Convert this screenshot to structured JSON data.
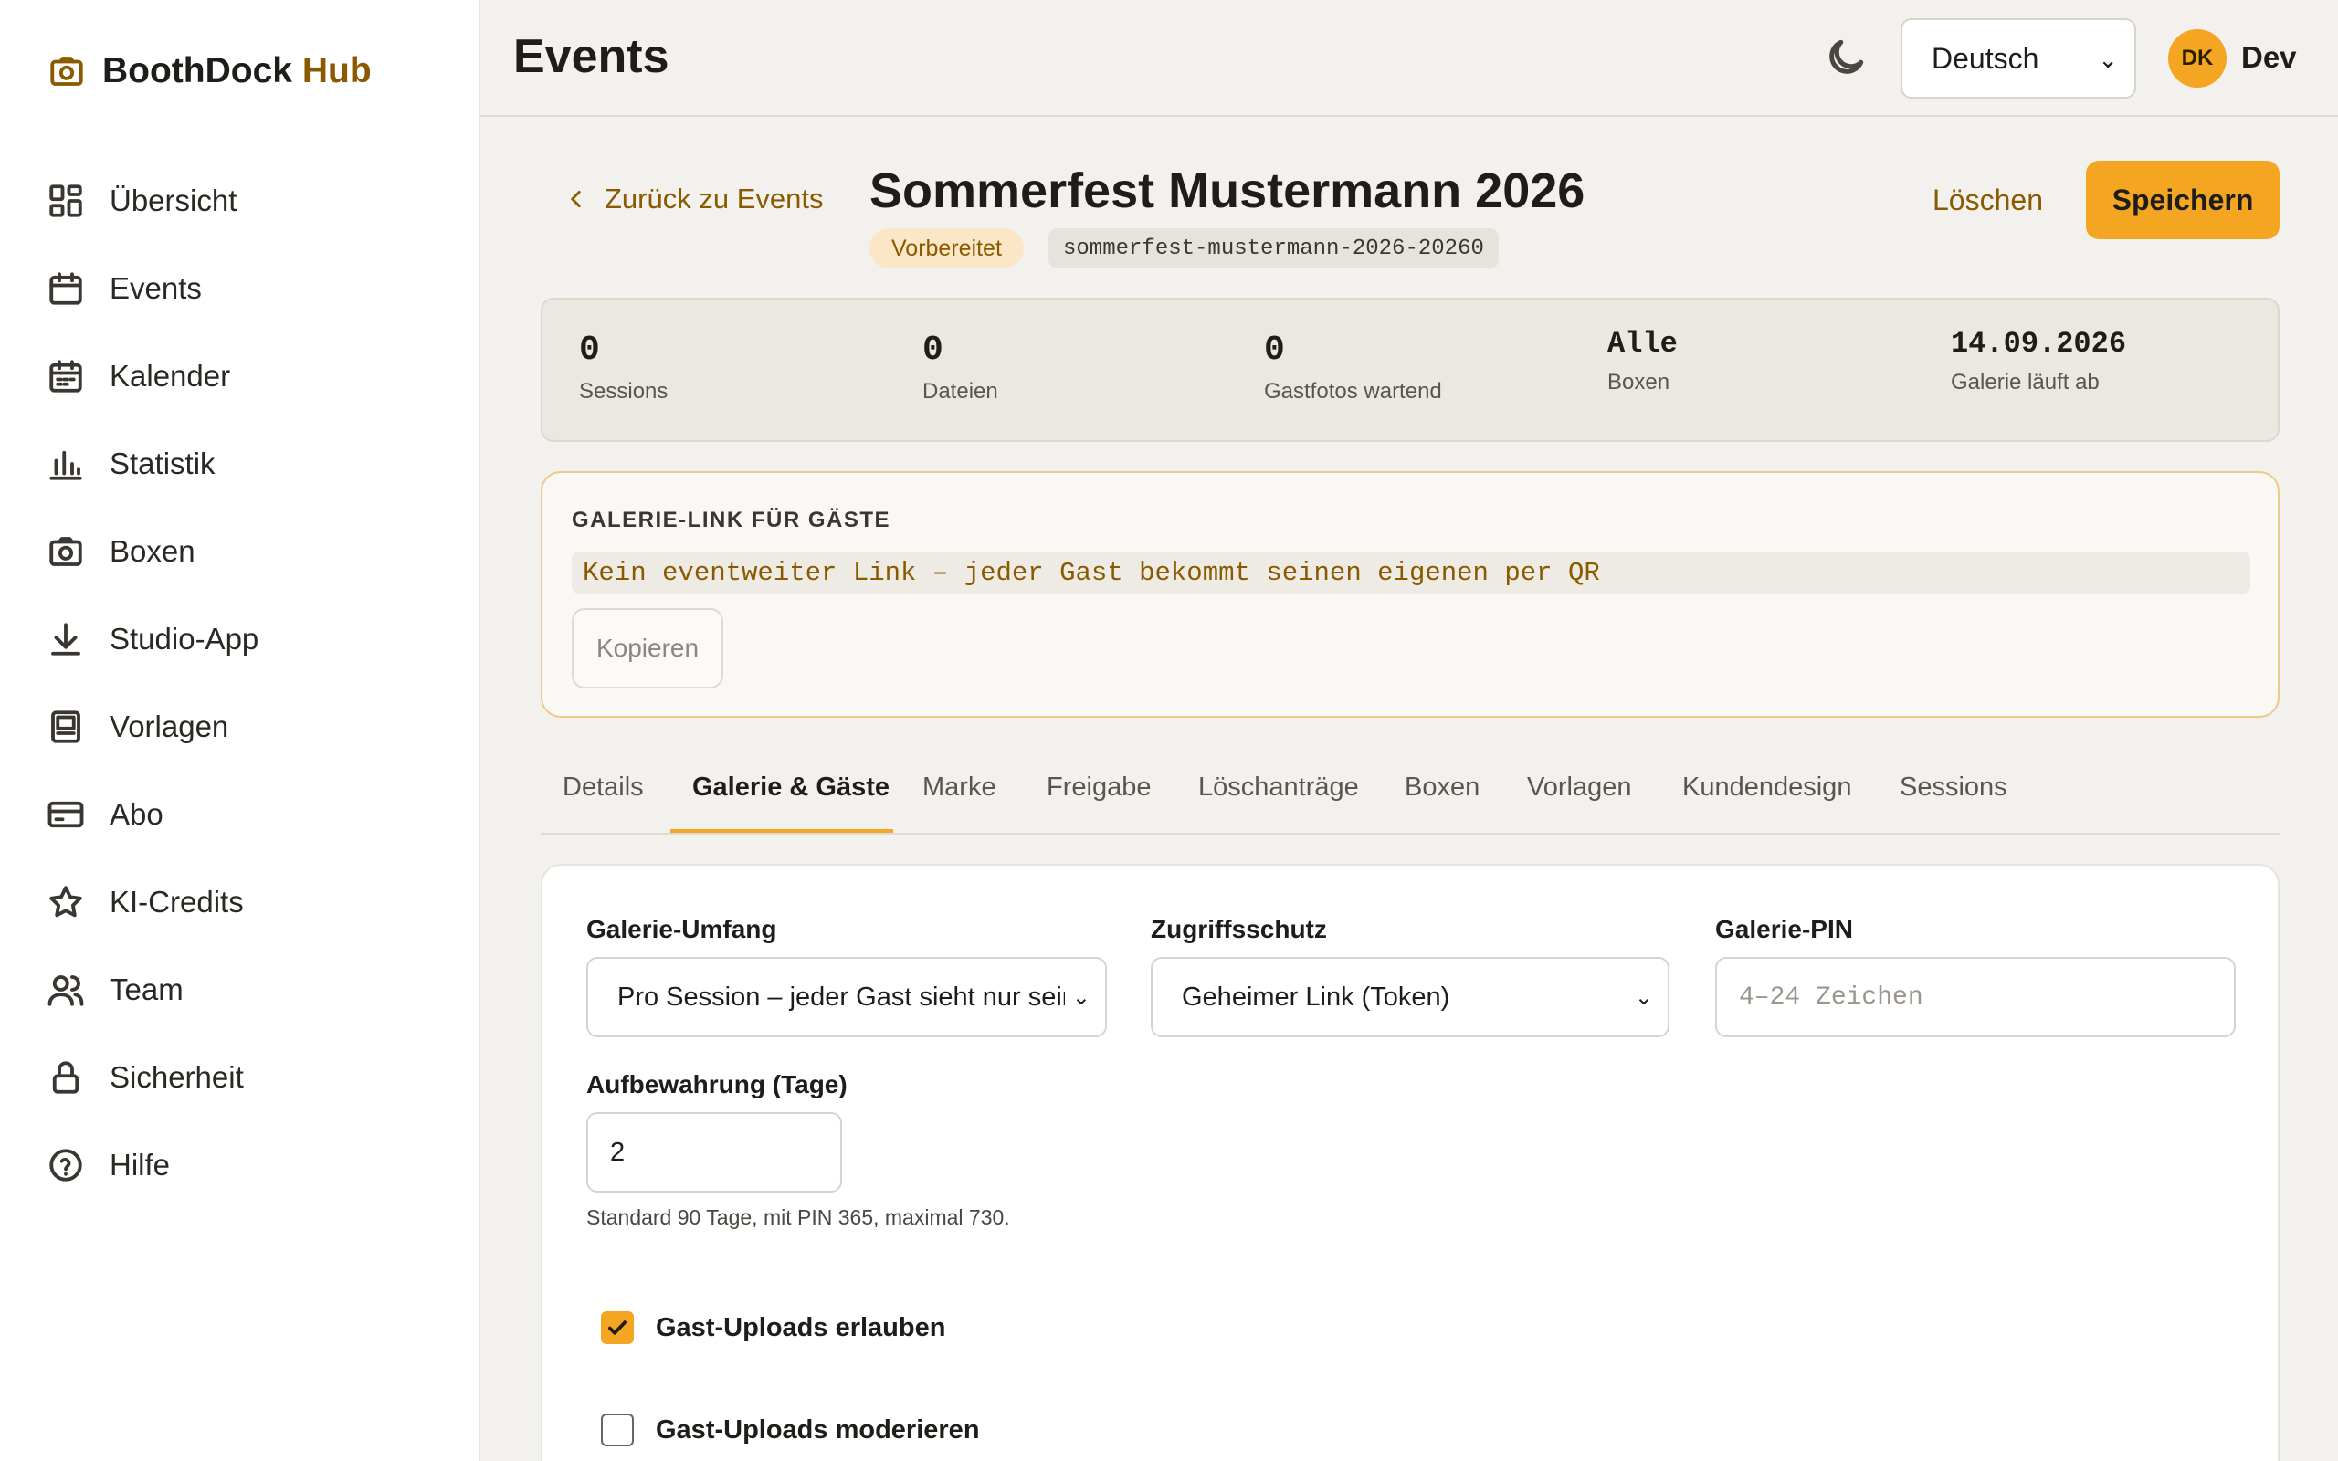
{
  "app": {
    "brand_main": "BoothDock",
    "brand_accent": "Hub",
    "accent_color": "#f4a623",
    "brand_color": "#8a5a00"
  },
  "sidebar": {
    "items": [
      {
        "label": "Übersicht",
        "icon": "dashboard-icon"
      },
      {
        "label": "Events",
        "icon": "calendar-icon"
      },
      {
        "label": "Kalender",
        "icon": "calendar-grid-icon"
      },
      {
        "label": "Statistik",
        "icon": "bar-chart-icon"
      },
      {
        "label": "Boxen",
        "icon": "camera-icon"
      },
      {
        "label": "Studio-App",
        "icon": "download-icon"
      },
      {
        "label": "Vorlagen",
        "icon": "template-icon"
      },
      {
        "label": "Abo",
        "icon": "credit-card-icon"
      },
      {
        "label": "KI-Credits",
        "icon": "star-icon"
      },
      {
        "label": "Team",
        "icon": "users-icon"
      },
      {
        "label": "Sicherheit",
        "icon": "lock-icon"
      },
      {
        "label": "Hilfe",
        "icon": "help-circle-icon"
      }
    ]
  },
  "header": {
    "title": "Events",
    "language": "Deutsch",
    "avatar_initials": "DK",
    "user_name": "Dev"
  },
  "event": {
    "back_label": "Zurück zu Events",
    "title": "Sommerfest Mustermann 2026",
    "status": "Vorbereitet",
    "slug": "sommerfest-mustermann-2026-20260",
    "delete_label": "Löschen",
    "save_label": "Speichern"
  },
  "stats": [
    {
      "value": "0",
      "label": "Sessions"
    },
    {
      "value": "0",
      "label": "Dateien"
    },
    {
      "value": "0",
      "label": "Gastfotos wartend"
    },
    {
      "value": "Alle",
      "label": "Boxen"
    },
    {
      "value": "14.09.2026",
      "label": "Galerie läuft ab"
    }
  ],
  "gallery_link": {
    "title": "GALERIE-LINK FÜR GÄSTE",
    "text": "Kein eventweiter Link – jeder Gast bekommt seinen eigenen per QR",
    "copy_label": "Kopieren"
  },
  "tabs": [
    {
      "label": "Details",
      "active": false
    },
    {
      "label": "Galerie & Gäste",
      "active": true
    },
    {
      "label": "Marke",
      "active": false
    },
    {
      "label": "Freigabe",
      "active": false
    },
    {
      "label": "Löschanträge",
      "active": false
    },
    {
      "label": "Boxen",
      "active": false
    },
    {
      "label": "Vorlagen",
      "active": false
    },
    {
      "label": "Kundendesign",
      "active": false
    },
    {
      "label": "Sessions",
      "active": false
    }
  ],
  "form": {
    "scope_label": "Galerie-Umfang",
    "scope_value": "Pro Session – jeder Gast sieht nur seine",
    "access_label": "Zugriffsschutz",
    "access_value": "Geheimer Link (Token)",
    "pin_label": "Galerie-PIN",
    "pin_placeholder": "4–24 Zeichen",
    "retention_label": "Aufbewahrung (Tage)",
    "retention_value": "2",
    "retention_help": "Standard 90 Tage, mit PIN 365, maximal 730.",
    "uploads_allow_label": "Gast-Uploads erlauben",
    "uploads_allow_checked": true,
    "uploads_moderate_label": "Gast-Uploads moderieren",
    "uploads_moderate_checked": false
  }
}
